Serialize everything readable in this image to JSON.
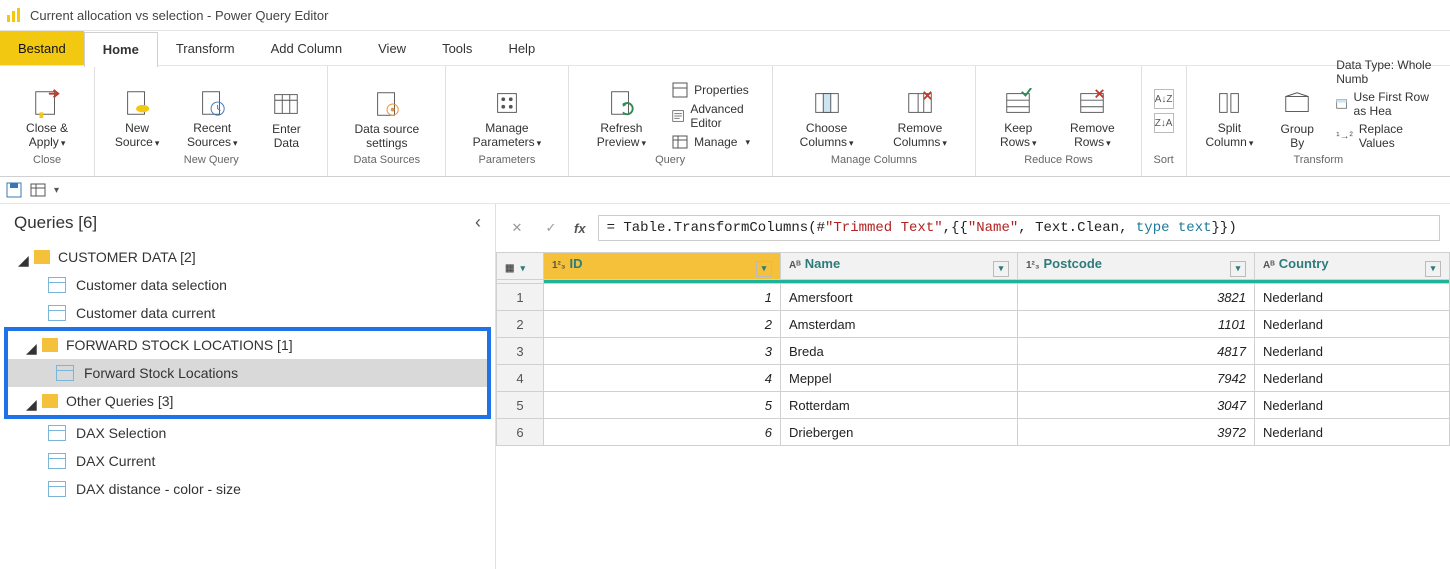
{
  "title": "Current allocation vs selection - Power Query Editor",
  "menu": {
    "file": "Bestand",
    "home": "Home",
    "transform": "Transform",
    "addcol": "Add Column",
    "view": "View",
    "tools": "Tools",
    "help": "Help"
  },
  "ribbon": {
    "close": {
      "btn": "Close &\nApply",
      "group": "Close"
    },
    "newquery": {
      "new": "New\nSource",
      "recent": "Recent\nSources",
      "enter": "Enter\nData",
      "group": "New Query"
    },
    "ds": {
      "btn": "Data source\nsettings",
      "group": "Data Sources"
    },
    "params": {
      "btn": "Manage\nParameters",
      "group": "Parameters"
    },
    "query": {
      "refresh": "Refresh\nPreview",
      "props": "Properties",
      "adv": "Advanced Editor",
      "manage": "Manage",
      "group": "Query"
    },
    "cols": {
      "choose": "Choose\nColumns",
      "remove": "Remove\nColumns",
      "group": "Manage Columns"
    },
    "rows": {
      "keep": "Keep\nRows",
      "remove": "Remove\nRows",
      "group": "Reduce Rows"
    },
    "sort": {
      "group": "Sort"
    },
    "transform": {
      "split": "Split\nColumn",
      "group": "Group\nBy",
      "dtype": "Data Type: Whole Numb",
      "first": "Use First Row as Hea",
      "replace": "Replace Values",
      "glabel": "Transform"
    }
  },
  "side": {
    "title": "Queries [6]",
    "g1": "CUSTOMER DATA [2]",
    "g1a": "Customer data selection",
    "g1b": "Customer data current",
    "g2": "FORWARD STOCK LOCATIONS [1]",
    "g2a": "Forward Stock Locations",
    "g3": "Other Queries [3]",
    "g3a": "DAX Selection",
    "g3b": "DAX Current",
    "g3c": "DAX distance - color - size"
  },
  "formula": {
    "p1": "= Table.TransformColumns(#",
    "p2": "\"Trimmed Text\"",
    "p3": ",{{",
    "p4": "\"Name\"",
    "p5": ", Text.Clean, ",
    "p6": "type text",
    "p7": "}})"
  },
  "chart_data": {
    "type": "table",
    "columns": [
      "ID",
      "Name",
      "Postcode",
      "Country"
    ],
    "column_types": [
      "Whole Number",
      "Text",
      "Whole Number",
      "Text"
    ],
    "rows": [
      {
        "ID": 1,
        "Name": "Amersfoort",
        "Postcode": 3821,
        "Country": "Nederland"
      },
      {
        "ID": 2,
        "Name": "Amsterdam",
        "Postcode": 1101,
        "Country": "Nederland"
      },
      {
        "ID": 3,
        "Name": "Breda",
        "Postcode": 4817,
        "Country": "Nederland"
      },
      {
        "ID": 4,
        "Name": "Meppel",
        "Postcode": 7942,
        "Country": "Nederland"
      },
      {
        "ID": 5,
        "Name": "Rotterdam",
        "Postcode": 3047,
        "Country": "Nederland"
      },
      {
        "ID": 6,
        "Name": "Driebergen",
        "Postcode": 3972,
        "Country": "Nederland"
      }
    ]
  }
}
